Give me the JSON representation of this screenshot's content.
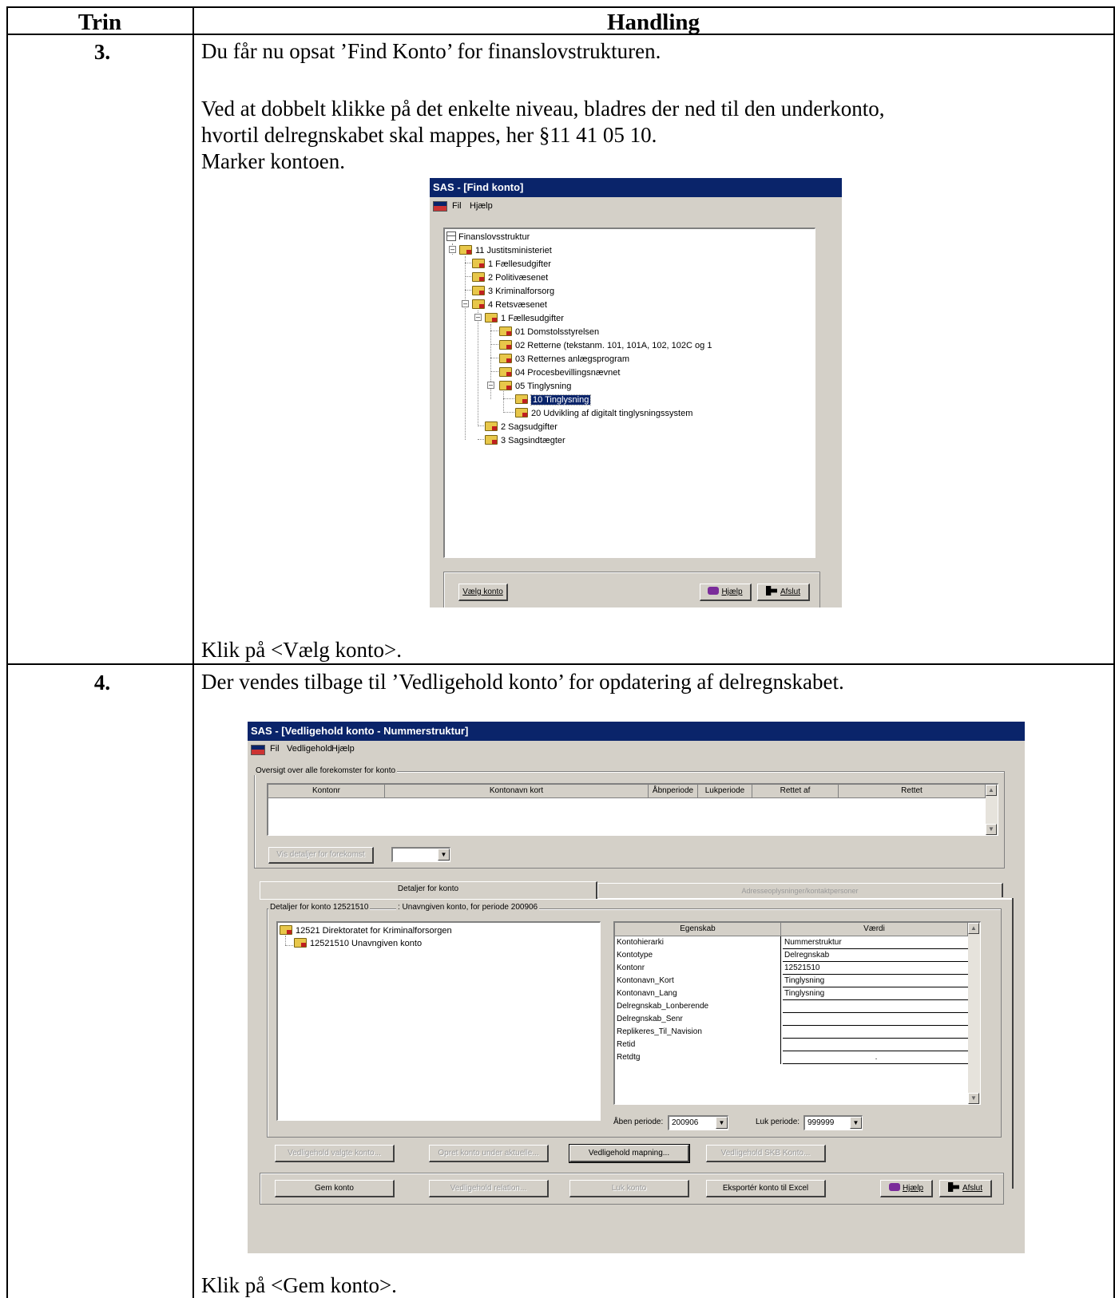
{
  "table": {
    "headers": {
      "step": "Trin",
      "action": "Handling"
    },
    "steps": [
      {
        "number": "3.",
        "lines": [
          "Du får nu opsat ’Find Konto’ for finanslovstrukturen.",
          "Ved at dobbelt klikke på det enkelte niveau, bladres der ned til den underkonto,",
          "hvortil delregnskabet skal mappes, her §11 41 05 10.",
          "Marker kontoen."
        ],
        "footer": "Klik på <Vælg konto>."
      },
      {
        "number": "4.",
        "lines": [
          "Der vendes tilbage til ’Vedligehold konto’ for opdatering af delregnskabet."
        ],
        "footer": "Klik på <Gem konto>."
      }
    ]
  },
  "find_konto_window": {
    "title": "SAS - [Find konto]",
    "menu": [
      "Fil",
      "Hjælp"
    ],
    "tree": {
      "root": "Finanslovsstruktur",
      "items": [
        "11  Justitsministeriet",
        "1  Fællesudgifter",
        "2  Politivæsenet",
        "3  Kriminalforsorg",
        "4  Retsvæsenet",
        "1  Fællesudgifter",
        "01  Domstolsstyrelsen",
        "02  Retterne (tekstanm. 101, 101A, 102, 102C og 1",
        "03  Retternes anlægsprogram",
        "04  Procesbevillingsnævnet",
        "05  Tinglysning",
        "10  Tinglysning",
        "20  Udvikling af digitalt tinglysningssystem",
        "2  Sagsudgifter",
        "3  Sagsindtægter"
      ]
    },
    "buttons": {
      "select": "Vælg konto",
      "help": "Hjælp",
      "exit": "Afslut"
    }
  },
  "vedligehold_window": {
    "title": "SAS - [Vedligehold konto - Nummerstruktur]",
    "menu": [
      "Fil",
      "Vedligehold",
      "Hjælp"
    ],
    "overview_group": "Oversigt over alle forekomster for konto",
    "columns": [
      "Kontonr",
      "Kontonavn kort",
      "Åbnperiode",
      "Lukperiode",
      "Rettet af",
      "Rettet"
    ],
    "details_btn": "Vis detaljer for forekomst",
    "tabs": [
      "Detaljer for konto",
      "Adresseoplysninger/kontaktpersoner"
    ],
    "details_label": "Detaljer for konto 12521510",
    "details_desc": ": Unavngiven konto, for periode 200906",
    "tree": [
      "12521 Direktoratet for Kriminalforsorgen",
      "12521510 Unavngiven konto"
    ],
    "props_headers": {
      "key": "Egenskab",
      "value": "Værdi"
    },
    "props": [
      {
        "k": "Kontohierarki",
        "v": "Nummerstruktur"
      },
      {
        "k": "Kontotype",
        "v": "Delregnskab"
      },
      {
        "k": "Kontonr",
        "v": "12521510"
      },
      {
        "k": "Kontonavn_Kort",
        "v": "Tinglysning"
      },
      {
        "k": "Kontonavn_Lang",
        "v": "Tinglysning"
      },
      {
        "k": "Delregnskab_Lonberende",
        "v": ""
      },
      {
        "k": "Delregnskab_Senr",
        "v": ""
      },
      {
        "k": "Replikeres_Til_Navision",
        "v": ""
      },
      {
        "k": "Retid",
        "v": ""
      },
      {
        "k": "Retdtg",
        "v": "."
      }
    ],
    "aaben_label": "Åben periode:",
    "aaben_value": "200906",
    "luk_label": "Luk periode:",
    "luk_value": "999999",
    "row_buttons": [
      "Vedligehold valgte konto...",
      "Opret konto under aktuelle...",
      "Vedligehold mapning...",
      "Vedligehold SKB Konto..."
    ],
    "bottom_buttons": [
      "Gem konto",
      "Vedligehold relation...",
      "Luk konto",
      "Eksportér konto til Excel"
    ],
    "help": "Hjælp",
    "exit": "Afslut"
  }
}
